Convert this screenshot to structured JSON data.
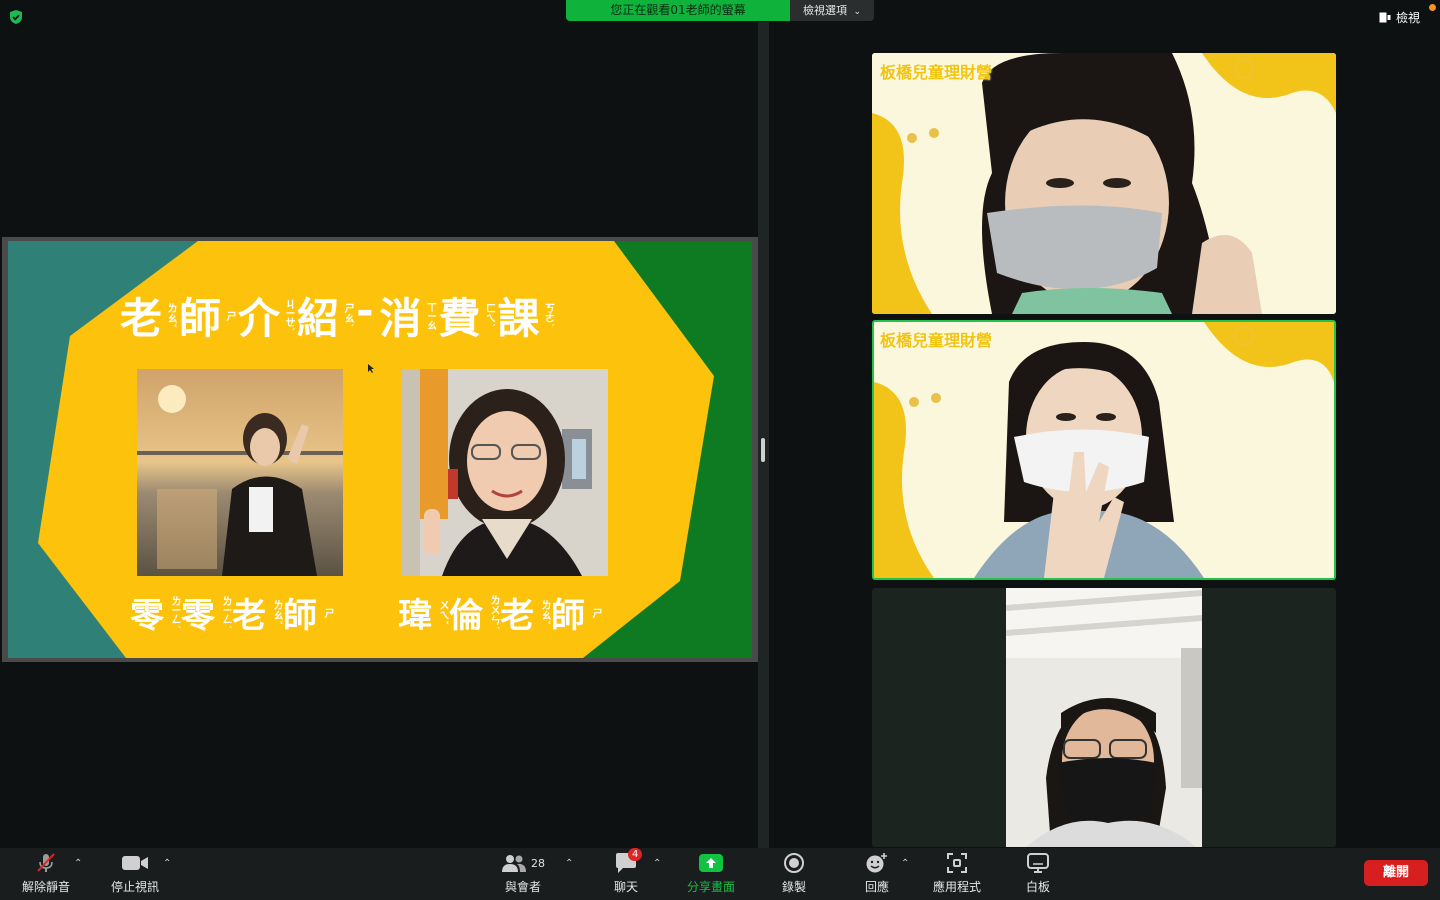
{
  "top_bar": {
    "banner_text": "您正在觀看01老師的螢幕",
    "view_options_label": "檢視選項",
    "view_button_label": "檢視"
  },
  "slide": {
    "title_chars": [
      "老",
      "師",
      "介",
      "紹",
      "-",
      "消",
      "費",
      "課"
    ],
    "title_zhuyin": [
      "ㄌㄠˇ",
      "ㄕ",
      "ㄐㄧㄝˋ",
      "ㄕㄠˋ",
      "",
      "ㄒㄧㄠ",
      "ㄈㄟˋ",
      "ㄎㄜˋ"
    ],
    "teacher_left": {
      "chars": [
        "零",
        "零",
        "老",
        "師"
      ],
      "zhuyin": [
        "ㄌㄧㄥˊ",
        "ㄌㄧㄥˊ",
        "ㄌㄠˇ",
        "ㄕ"
      ]
    },
    "teacher_right": {
      "chars": [
        "瑋",
        "倫",
        "老",
        "師"
      ],
      "zhuyin": [
        "ㄨㄟˇ",
        "ㄌㄨㄣˊ",
        "ㄌㄠˇ",
        "ㄕ"
      ]
    }
  },
  "tiles": [
    {
      "label": "板橋兒童理財營",
      "active": false
    },
    {
      "label": "板橋兒童理財營",
      "active": true
    },
    {
      "label": "",
      "active": false
    }
  ],
  "toolbar": {
    "unmute_label": "解除靜音",
    "stop_video_label": "停止視訊",
    "participants_label": "與會者",
    "participants_count": "28",
    "chat_label": "聊天",
    "chat_badge": "4",
    "share_label": "分享畫面",
    "record_label": "錄製",
    "reactions_label": "回應",
    "apps_label": "應用程式",
    "whiteboard_label": "白板",
    "leave_label": "離開"
  },
  "colors": {
    "share_green": "#0fb33c",
    "slide_yellow": "#fdc20b",
    "slide_teal": "#2f8177",
    "slide_green": "#0e7a22",
    "leave_red": "#d71f20",
    "active_border": "#22c24b"
  }
}
